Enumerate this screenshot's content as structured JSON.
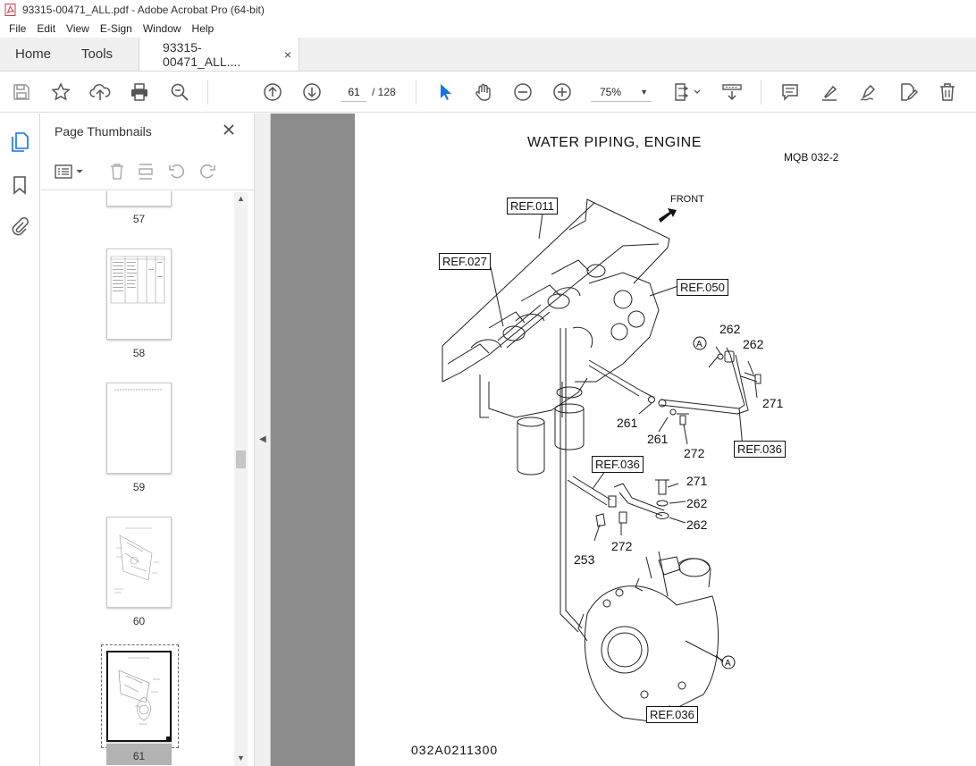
{
  "window": {
    "title": "93315-00471_ALL.pdf - Adobe Acrobat Pro (64-bit)"
  },
  "menu": {
    "items": [
      "File",
      "Edit",
      "View",
      "E-Sign",
      "Window",
      "Help"
    ]
  },
  "tabs": {
    "home": "Home",
    "tools": "Tools",
    "document": "93315-00471_ALL....",
    "close_glyph": "×"
  },
  "toolbar": {
    "current_page": "61",
    "page_total": "/  128",
    "zoom": "75%"
  },
  "thumbnails_panel": {
    "title": "Page Thumbnails",
    "pages": [
      {
        "label": "57"
      },
      {
        "label": "58"
      },
      {
        "label": "59"
      },
      {
        "label": "60"
      },
      {
        "label": "61",
        "selected": true
      }
    ]
  },
  "document_page": {
    "title": "WATER  PIPING, ENGINE",
    "code": "MQB 032-2",
    "footer": "032A0211300",
    "front_label": "FRONT",
    "refs": [
      "REF.011",
      "REF.027",
      "REF.050",
      "REF.036",
      "REF.036",
      "REF.036"
    ],
    "part_numbers": [
      "262",
      "262",
      "271",
      "261",
      "261",
      "272",
      "271",
      "262",
      "262",
      "253",
      "272"
    ],
    "callouts": [
      "A",
      "A"
    ]
  },
  "colors": {
    "accent_blue": "#1473e6",
    "doc_background": "#8c8c8c",
    "pdf_red": "#d7373f"
  }
}
